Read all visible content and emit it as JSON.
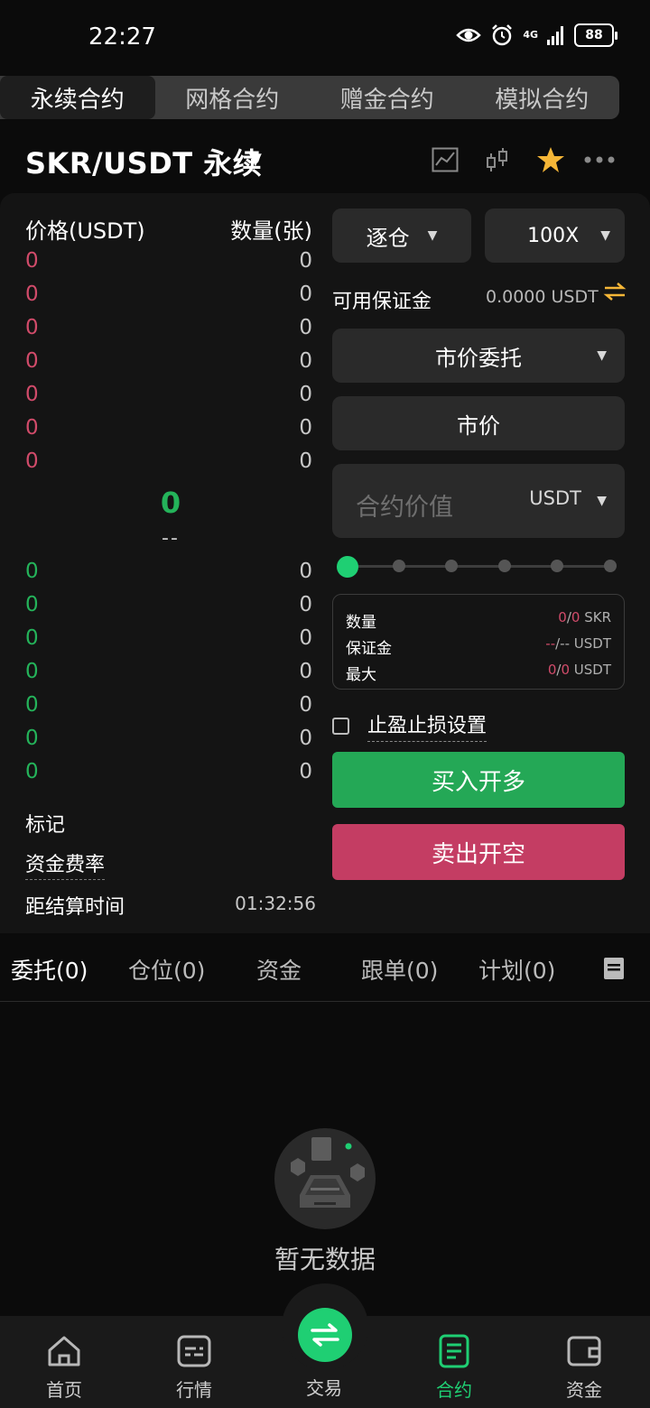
{
  "status_bar": {
    "time": "22:27",
    "network": "4G",
    "battery": "88"
  },
  "contract_tabs": [
    {
      "label": "永续合约",
      "active": true
    },
    {
      "label": "网格合约",
      "active": false
    },
    {
      "label": "赠金合约",
      "active": false
    },
    {
      "label": "模拟合约",
      "active": false
    }
  ],
  "pair": {
    "name": "SKR/USDT 永续"
  },
  "header_icons": [
    "chart-line-icon",
    "candlestick-icon",
    "star-icon",
    "more-icon"
  ],
  "orderbook": {
    "price_header": "价格(USDT)",
    "qty_header": "数量(张)",
    "asks": [
      {
        "price": "0",
        "qty": "0"
      },
      {
        "price": "0",
        "qty": "0"
      },
      {
        "price": "0",
        "qty": "0"
      },
      {
        "price": "0",
        "qty": "0"
      },
      {
        "price": "0",
        "qty": "0"
      },
      {
        "price": "0",
        "qty": "0"
      },
      {
        "price": "0",
        "qty": "0"
      }
    ],
    "last_price": "0",
    "last_price_sub": "--",
    "bids": [
      {
        "price": "0",
        "qty": "0"
      },
      {
        "price": "0",
        "qty": "0"
      },
      {
        "price": "0",
        "qty": "0"
      },
      {
        "price": "0",
        "qty": "0"
      },
      {
        "price": "0",
        "qty": "0"
      },
      {
        "price": "0",
        "qty": "0"
      },
      {
        "price": "0",
        "qty": "0"
      }
    ]
  },
  "market_info": {
    "mark_label": "标记",
    "funding_label": "资金费率",
    "settle_label": "距结算时间",
    "settle_value": "01:32:56"
  },
  "order_form": {
    "margin_mode": "逐仓",
    "leverage": "100X",
    "available_label": "可用保证金",
    "available_value": "0.0000 USDT",
    "order_type": "市价委托",
    "price_mode": "市价",
    "amount_placeholder": "合约价值",
    "amount_unit": "USDT",
    "slider_percent": 0,
    "summary": {
      "qty_label": "数量",
      "qty_value_a": "0",
      "qty_value_b": "0",
      "qty_unit": "SKR",
      "margin_label": "保证金",
      "margin_value_a": "--",
      "margin_value_b": "--",
      "margin_unit": "USDT",
      "max_label": "最大",
      "max_value_a": "0",
      "max_value_b": "0",
      "max_unit": "USDT"
    },
    "tpsl_label": "止盈止损设置",
    "buy_label": "买入开多",
    "sell_label": "卖出开空"
  },
  "position_tabs": [
    {
      "label": "委托(0)",
      "active": true
    },
    {
      "label": "仓位(0)",
      "active": false
    },
    {
      "label": "资金",
      "active": false
    },
    {
      "label": "跟单(0)",
      "active": false
    },
    {
      "label": "计划(0)",
      "active": false
    }
  ],
  "empty_state": {
    "text": "暂无数据"
  },
  "bottom_nav": [
    {
      "label": "首页",
      "icon": "home-icon",
      "active": false
    },
    {
      "label": "行情",
      "icon": "market-icon",
      "active": false
    },
    {
      "label": "交易",
      "icon": "swap-icon",
      "active": false
    },
    {
      "label": "合约",
      "icon": "contract-icon",
      "active": true
    },
    {
      "label": "资金",
      "icon": "wallet-icon",
      "active": false
    }
  ],
  "colors": {
    "accent_green": "#1fcf73",
    "ask_red": "#d14b6a",
    "buy_green": "#24a856",
    "sell_red": "#c43d63"
  }
}
